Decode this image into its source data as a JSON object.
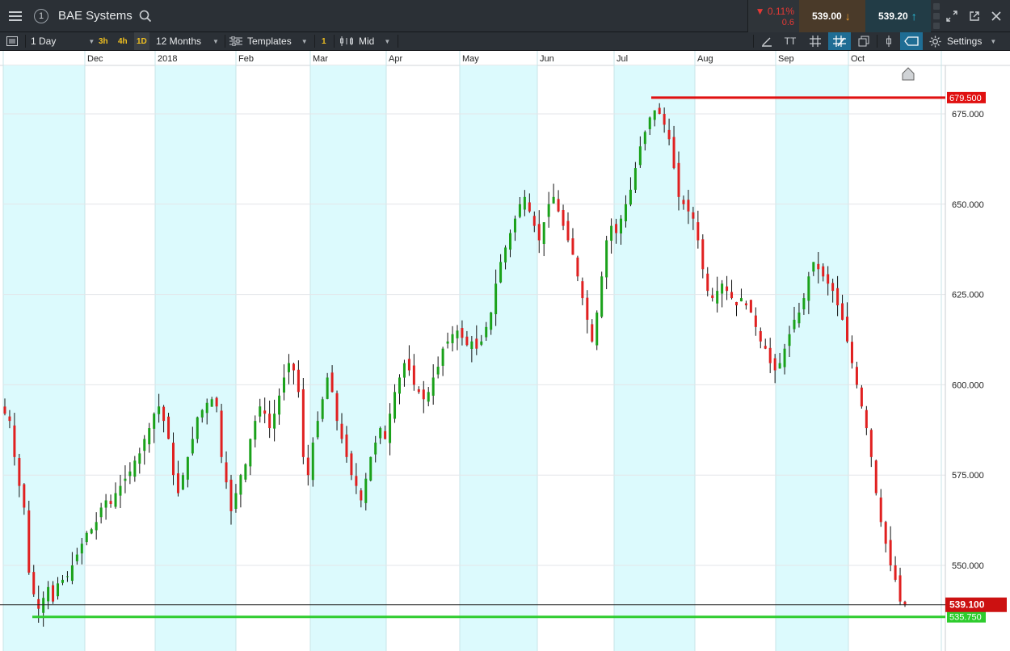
{
  "window": {
    "link_number": "1",
    "title": "BAE Systems"
  },
  "quote": {
    "change_pct": "0.11%",
    "change_abs": "0.6",
    "change_dir_symbol": "▼",
    "sell_price": "539.00",
    "buy_price": "539.20",
    "sell_arrow": "↓",
    "buy_arrow": "↑",
    "down_color": "#e53935",
    "sell_color": "#4a3a29",
    "buy_color": "#223c46"
  },
  "toolbar": {
    "interval": "1 Day",
    "quick_timeframes": [
      "3h",
      "4h",
      "1D"
    ],
    "range": "12 Months",
    "templates_label": "Templates",
    "badge": "1",
    "price_type": "Mid",
    "settings_label": "Settings",
    "text_tool_label": "TT"
  },
  "icons": {
    "menu": "hamburger-icon",
    "search": "search-icon",
    "expand": "expand-icon",
    "popout": "popout-icon",
    "close": "close-icon",
    "draw": "pencil-icon",
    "crosshair": "crosshair-icon",
    "grid": "grid-icon",
    "layers": "layers-icon",
    "tag": "tag-icon",
    "gear": "gear-icon",
    "home": "home-marker-icon"
  },
  "chart_data": {
    "type": "candlestick",
    "title": "BAE Systems",
    "period": "1 Day",
    "range": "12 Months",
    "x_labels": [
      "Dec",
      "2018",
      "Feb",
      "Mar",
      "Apr",
      "May",
      "Jun",
      "Jul",
      "Aug",
      "Sep",
      "Oct"
    ],
    "y_ticks": [
      "550.000",
      "575.000",
      "600.000",
      "625.000",
      "650.000",
      "675.000"
    ],
    "y_tick_values": [
      550,
      575,
      600,
      625,
      650,
      675
    ],
    "ylim": [
      533.5,
      690
    ],
    "up_color": "#1aa11a",
    "down_color": "#e02020",
    "high_line": {
      "value": 679.5,
      "label": "679.500",
      "color": "#e01010"
    },
    "low_line": {
      "value": 535.75,
      "label": "535.750",
      "color": "#2ecc2e"
    },
    "current_price": {
      "value": 539.1,
      "label": "539.100",
      "color": "#cc1111"
    },
    "shaded_months": [
      "Nov",
      "Jan",
      "Mar",
      "May",
      "Jul",
      "Sep"
    ],
    "grid": true,
    "candles_close": [
      592,
      590,
      580,
      572,
      566,
      548,
      542,
      538,
      541,
      544,
      540,
      545,
      546,
      547,
      550,
      553,
      556,
      559,
      560,
      562,
      566,
      568,
      567,
      570,
      572,
      574,
      576,
      579,
      581,
      585,
      588,
      592,
      594,
      590,
      585,
      575,
      570,
      575,
      580,
      585,
      591,
      593,
      595,
      596,
      594,
      580,
      573,
      565,
      570,
      575,
      578,
      585,
      590,
      594,
      592,
      588,
      592,
      597,
      602,
      606,
      604,
      598,
      580,
      575,
      584,
      590,
      596,
      602,
      598,
      590,
      585,
      580,
      575,
      572,
      568,
      574,
      580,
      584,
      588,
      585,
      592,
      598,
      602,
      606,
      604,
      600,
      598,
      596,
      598,
      602,
      605,
      610,
      612,
      614,
      615,
      613,
      611,
      612,
      610,
      612,
      616,
      620,
      628,
      634,
      638,
      642,
      646,
      650,
      652,
      648,
      644,
      640,
      645,
      650,
      652,
      648,
      644,
      640,
      636,
      630,
      624,
      618,
      612,
      620,
      630,
      640,
      644,
      642,
      646,
      650,
      654,
      660,
      666,
      670,
      674,
      676,
      675,
      672,
      668,
      660,
      652,
      650,
      648,
      646,
      640,
      632,
      626,
      624,
      626,
      628,
      626,
      624,
      622,
      624,
      622,
      620,
      616,
      612,
      610,
      606,
      604,
      606,
      610,
      614,
      618,
      620,
      624,
      630,
      634,
      632,
      630,
      628,
      626,
      622,
      618,
      612,
      606,
      600,
      594,
      588,
      580,
      570,
      562,
      556,
      550,
      546,
      540,
      539
    ]
  }
}
